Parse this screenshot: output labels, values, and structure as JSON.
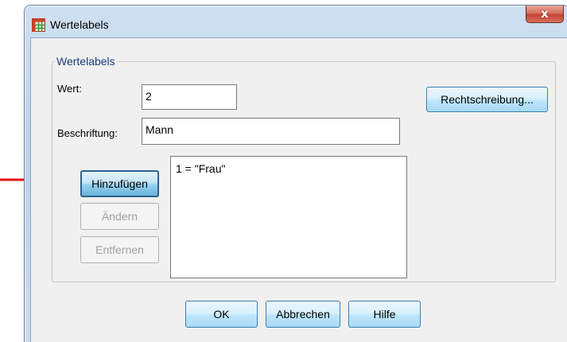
{
  "window": {
    "title": "Wertelabels",
    "close_label": "x"
  },
  "group": {
    "label": "Wertelabels"
  },
  "value_field": {
    "label": "Wert:",
    "value": "2"
  },
  "caption_field": {
    "label": "Beschriftung:",
    "value": "Mann"
  },
  "buttons": {
    "spelling": "Rechtschreibung...",
    "add": "Hinzufügen",
    "change": "Ändern",
    "remove": "Entfernen",
    "ok": "OK",
    "cancel": "Abbrechen",
    "help": "Hilfe"
  },
  "label_list": {
    "items": [
      "1 = \"Frau\""
    ]
  },
  "colors": {
    "annotation_arrow": "#e8131b",
    "group_label": "#1a3d7c",
    "window_frame": "#bcd3ea"
  },
  "icons": {
    "title": "spss-data-grid-icon",
    "annotation": "red-arrow-icon"
  }
}
